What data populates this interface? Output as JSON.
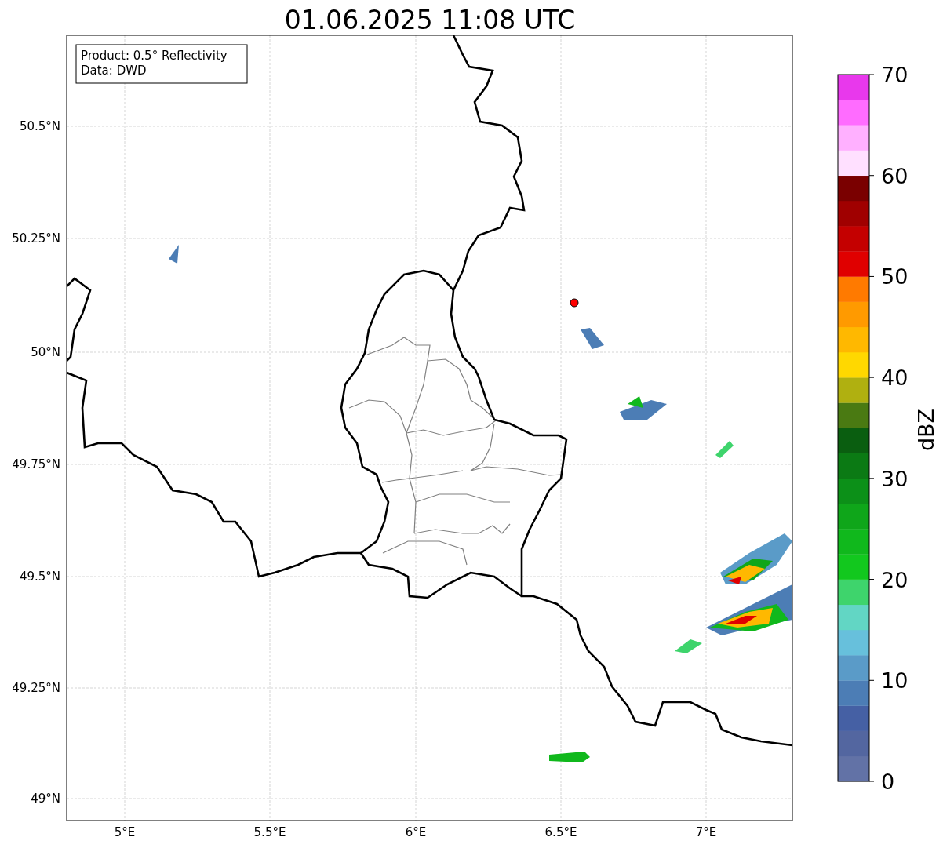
{
  "title": "01.06.2025 11:08 UTC",
  "info_box": {
    "lines": [
      "Product: 0.5° Reflectivity",
      "Data: DWD"
    ]
  },
  "map": {
    "x_ticks": [
      "5°E",
      "5.5°E",
      "6°E",
      "6.5°E",
      "7°E"
    ],
    "y_ticks": [
      "50.5°N",
      "50.25°N",
      "50°N",
      "49.75°N",
      "49.5°N",
      "49.25°N",
      "49°N"
    ]
  },
  "colorbar": {
    "label": "dBZ",
    "ticks": [
      "70",
      "60",
      "50",
      "40",
      "30",
      "20",
      "10",
      "0"
    ],
    "segments": [
      {
        "color": "#6272a6"
      },
      {
        "color": "#5366a0"
      },
      {
        "color": "#4560a4"
      },
      {
        "color": "#4c7db5"
      },
      {
        "color": "#5a9bc8"
      },
      {
        "color": "#67c0dc"
      },
      {
        "color": "#62d6c4"
      },
      {
        "color": "#3ed46c"
      },
      {
        "color": "#12c81e"
      },
      {
        "color": "#10b81c"
      },
      {
        "color": "#0fa61a"
      },
      {
        "color": "#0c9018"
      },
      {
        "color": "#0b7a14"
      },
      {
        "color": "#0a5e10"
      },
      {
        "color": "#4a7a12"
      },
      {
        "color": "#b0b010"
      },
      {
        "color": "#ffd800"
      },
      {
        "color": "#ffb800"
      },
      {
        "color": "#ff9a00"
      },
      {
        "color": "#ff7a00"
      },
      {
        "color": "#e00000"
      },
      {
        "color": "#c40000"
      },
      {
        "color": "#a00000"
      },
      {
        "color": "#7a0000"
      },
      {
        "color": "#ffe0ff"
      },
      {
        "color": "#ffb0ff"
      },
      {
        "color": "#ff6cff"
      },
      {
        "color": "#e838ec"
      }
    ]
  }
}
